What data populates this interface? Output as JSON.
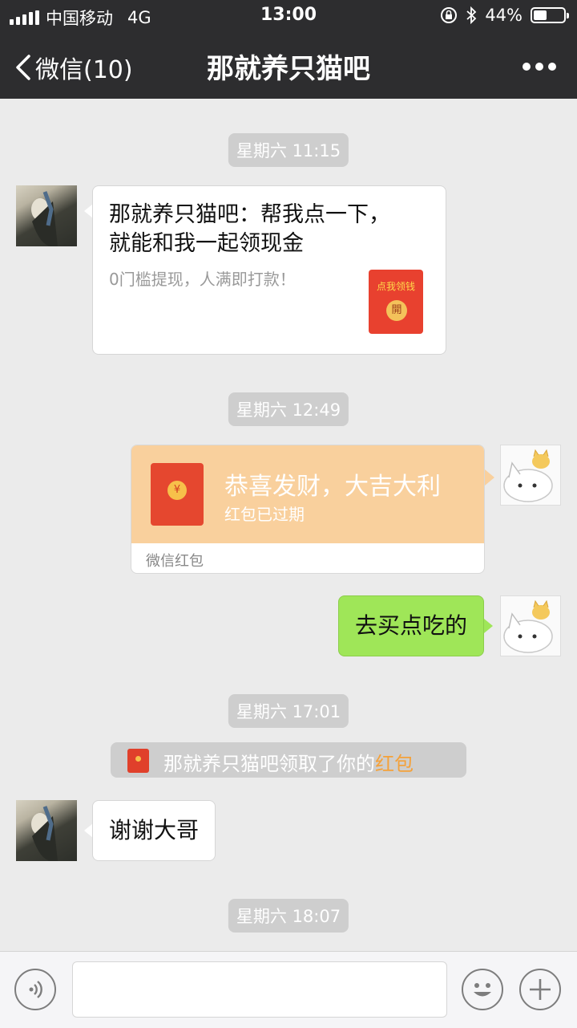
{
  "status_bar": {
    "carrier": "中国移动",
    "network": "4G",
    "time": "13:00",
    "battery_percent": "44%",
    "battery_level": 0.44
  },
  "header": {
    "back_label": "微信(10)",
    "title": "那就养只猫吧",
    "more_icon": "more-dots-icon"
  },
  "messages": {
    "ts1": "星期六 11:15",
    "link_card": {
      "title": "那就养只猫吧：帮我点一下，就能和我一起领现金",
      "desc": "0门槛提现，人满即打款！",
      "thumb_label": "点我领钱",
      "thumb_button": "開"
    },
    "ts2": "星期六 12:49",
    "red_packet": {
      "title": "恭喜发财，大吉大利",
      "status": "红包已过期",
      "footer": "微信红包",
      "coin": "¥"
    },
    "sent_text": "去买点吃的",
    "ts3": "星期六 17:01",
    "system": {
      "text": "那就养只猫吧领取了你的",
      "link": "红包"
    },
    "received_text": "谢谢大哥",
    "ts4": "星期六 18:07"
  },
  "input": {
    "placeholder": ""
  },
  "colors": {
    "header_bg": "#2d2d2f",
    "chat_bg": "#ebebeb",
    "sent_bubble": "#9fe658",
    "red_packet": "#f9d09d",
    "link_orange": "#f4a13a"
  }
}
